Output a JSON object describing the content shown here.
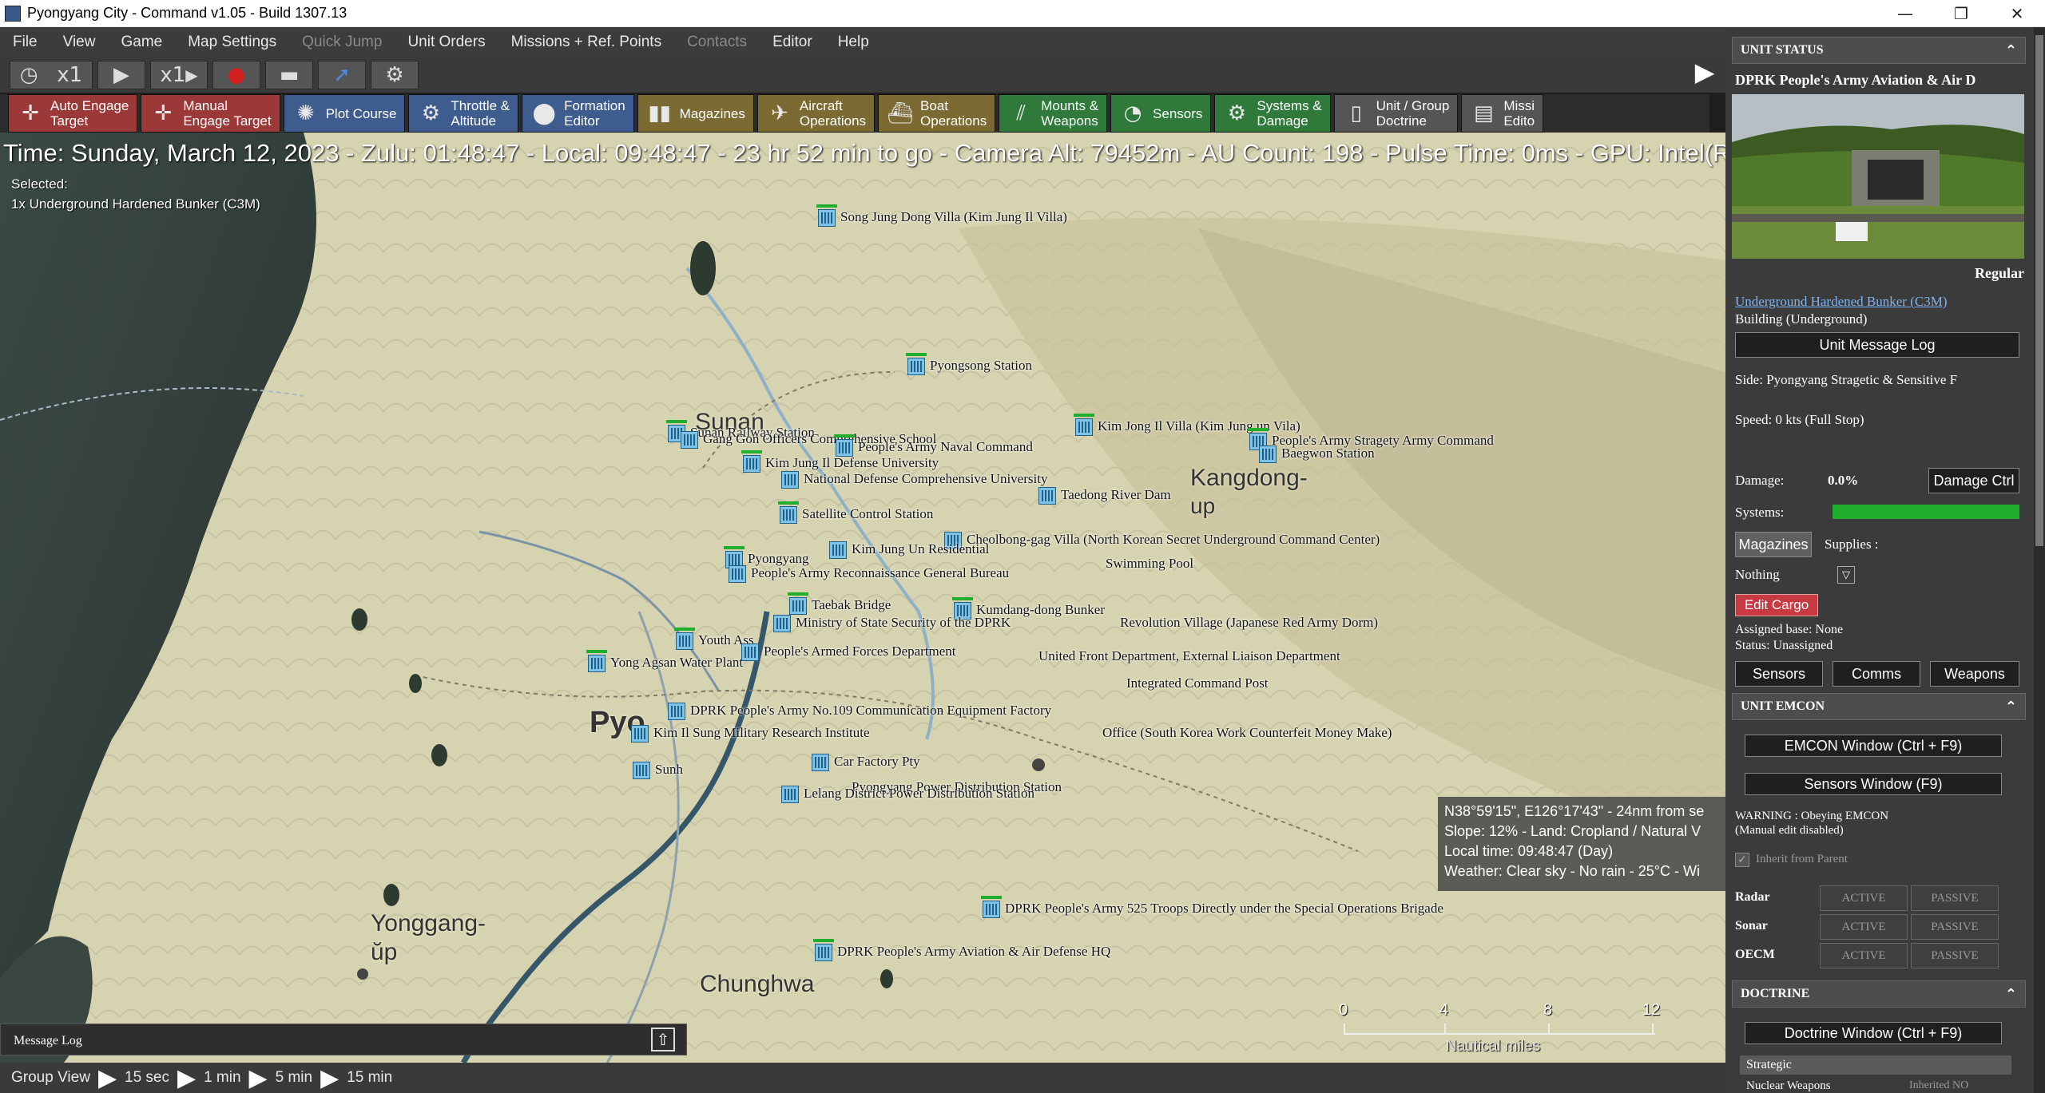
{
  "window": {
    "title": "Pyongyang City - Command v1.05 - Build 1307.13",
    "min": "—",
    "restore": "❐",
    "close": "✕"
  },
  "menu": [
    "File",
    "View",
    "Game",
    "Map Settings",
    "Quick Jump",
    "Unit Orders",
    "Missions + Ref. Points",
    "Contacts",
    "Editor",
    "Help"
  ],
  "time_controls": {
    "speed_label": "x1",
    "step_label": "x1"
  },
  "toolbar": [
    {
      "label": "Auto Engage\nTarget",
      "icon": "crosshair-icon",
      "color": "red"
    },
    {
      "label": "Manual\nEngage Target",
      "icon": "crosshair-icon",
      "color": "red"
    },
    {
      "label": "Plot Course",
      "icon": "compass-icon",
      "color": "blue"
    },
    {
      "label": "Throttle &\nAltitude",
      "icon": "throttle-icon",
      "color": "blue"
    },
    {
      "label": "Formation\nEditor",
      "icon": "formation-icon",
      "color": "blue"
    },
    {
      "label": "Magazines",
      "icon": "magazine-icon",
      "color": "olive"
    },
    {
      "label": "Aircraft\nOperations",
      "icon": "aircraft-icon",
      "color": "olive"
    },
    {
      "label": "Boat\nOperations",
      "icon": "boat-icon",
      "color": "olive"
    },
    {
      "label": "Mounts &\nWeapons",
      "icon": "weapons-icon",
      "color": "green"
    },
    {
      "label": "Sensors",
      "icon": "sensor-icon",
      "color": "green"
    },
    {
      "label": "Systems &\nDamage",
      "icon": "gear-icon",
      "color": "green"
    },
    {
      "label": "Unit / Group\nDoctrine",
      "icon": "document-icon",
      "color": "grey"
    },
    {
      "label": "Missi\nEdito",
      "icon": "mission-icon",
      "color": "grey"
    }
  ],
  "status_line": "Time: Sunday, March 12, 2023 - Zulu: 01:48:47 - Local: 09:48:47 - 23 hr 52 min to go -  Camera Alt: 79452m  - AU Count: 198 - Pulse Time: 0ms - GPU: Intel(R",
  "selected": {
    "label": "Selected:",
    "value": "1x Underground Hardened Bunker (C3M)"
  },
  "places": {
    "sunan": "Sunan",
    "kangdong": "Kangdong-",
    "kangdong2": "up",
    "yonggang": "Yonggang-",
    "yonggang2": "ŭp",
    "chunghwa": "Chunghwa",
    "pyong": "Pyo"
  },
  "units": [
    "Song Jung Dong Villa (Kim Jung Il Villa)",
    "Pyongsong Station",
    "Sunan Railway Station",
    "Gang Gon Officers Comprehensive School",
    "People's Army Naval Command",
    "Kim Jung Il Defense University",
    "National Defense Comprehensive University",
    "Kim Jong Il Villa (Kim Jung un Vila)",
    "People's Army Stragety Army Command",
    "Baegwon Station",
    "Taedong River Dam",
    "Satellite Control Station",
    "Cheolbong-gag Villa (North Korean Secret Underground Command Center)",
    "Kim Jung Un Residential",
    "Pyongyang",
    "People's Army Reconnaissance General Bureau",
    "Swimming Pool",
    "Taebak Bridge",
    "Kumdang-dong Bunker",
    "Revolution Village (Japanese Red Army Dorm)",
    "Ministry of State Security of the DPRK",
    "Youth Ass",
    "Yong Agsan Water Plant",
    "People's Armed Forces Department",
    "United Front Department, External Liaison Department",
    "Integrated Command Post",
    "DPRK People's Army No.109 Communication Equipment Factory",
    "Kim Il Sung Military Research Institute",
    "Office (South Korea Work Counterfeit Money Make)",
    "Car Factory Pty",
    "Sunh",
    "Pyongyang Power Distribution Station",
    "Lelang District Power Distribution Station",
    "DPRK People's Army 525 Troops Directly under the Special Operations Brigade",
    "DPRK People's Army Aviation & Air Defense HQ"
  ],
  "coord_box": {
    "line1": "N38°59'15\", E126°17'43\" - 24nm from se",
    "line2": "Slope: 12%  - Land: Cropland / Natural V",
    "line3": "Local time: 09:48:47 (Day)",
    "line4": "Weather: Clear sky - No rain - 25°C - Wi"
  },
  "scale": {
    "ticks": [
      "0",
      "4",
      "8",
      "12"
    ],
    "unit": "Nautical miles"
  },
  "message_log": {
    "label": "Message Log",
    "expand_icon": "⇧"
  },
  "bottombar": {
    "group_view": "Group View",
    "steps": [
      "15 sec",
      "1 min",
      "5 min",
      "15 min"
    ]
  },
  "panel": {
    "unit_status_header": "UNIT STATUS",
    "unit_name": "DPRK People's Army Aviation & Air D",
    "proficiency": "Regular",
    "class_link": "Underground Hardened Bunker (C3M)",
    "type": "Building (Underground)",
    "msg_log_btn": "Unit Message Log",
    "side": "Side: Pyongyang Stragetic & Sensitive F",
    "speed": "Speed: 0 kts (Full Stop)",
    "damage_label": "Damage:",
    "damage_value": "0.0%",
    "damage_ctrl_btn": "Damage Ctrl",
    "systems_label": "Systems:",
    "systems_health": 1.0,
    "magazines_btn": "Magazines",
    "supplies_label": "Supplies :",
    "cargo_select": "Nothing",
    "edit_cargo_btn": "Edit Cargo",
    "assigned_base": "Assigned base: None",
    "status": "Status: Unassigned",
    "sensors_btn": "Sensors",
    "comms_btn": "Comms",
    "weapons_btn": "Weapons",
    "emcon_header": "UNIT EMCON",
    "emcon_btn": "EMCON Window (Ctrl + F9)",
    "sensors_window_btn": "Sensors Window (F9)",
    "warning1": "WARNING : Obeying EMCON",
    "warning2": "(Manual edit disabled)",
    "inherit": "Inherit from Parent",
    "emcon_rows": [
      {
        "name": "Radar",
        "active": "ACTIVE",
        "passive": "PASSIVE"
      },
      {
        "name": "Sonar",
        "active": "ACTIVE",
        "passive": "PASSIVE"
      },
      {
        "name": "OECM",
        "active": "ACTIVE",
        "passive": "PASSIVE"
      }
    ],
    "doctrine_header": "DOCTRINE",
    "doctrine_btn": "Doctrine Window (Ctrl + F9)",
    "strategic": "Strategic",
    "nuclear": "Nuclear Weapons",
    "nuclear_state": "Inherited  NO"
  },
  "colors": {
    "accent_green": "#1fae2e",
    "unit_blue": "#7ec3e6",
    "edit_cargo_red": "#c73a42"
  }
}
